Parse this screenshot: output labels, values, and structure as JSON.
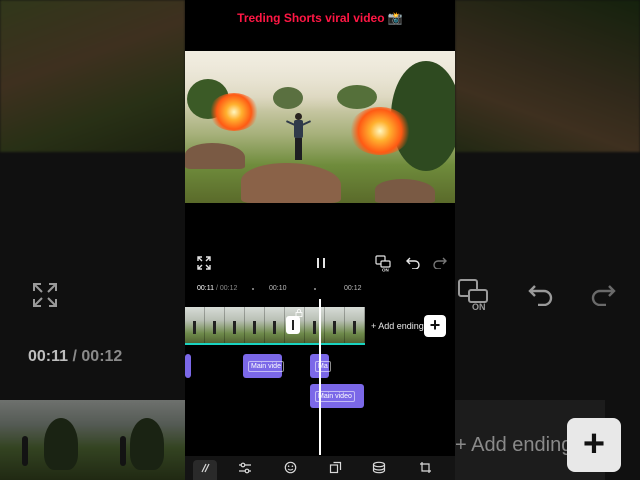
{
  "video_title": "Treding Shorts viral video 📸",
  "timeline": {
    "current_time": "00:11",
    "separator": " / ",
    "total_time": "00:12",
    "ruler_labels": [
      "00:10",
      "00:12"
    ]
  },
  "controls": {
    "fullscreen_icon": "fullscreen-icon",
    "pause_icon": "pause-icon",
    "keyframe_icon": "keyframe-on-icon",
    "keyframe_badge": "ON",
    "undo_icon": "undo-icon",
    "redo_icon": "redo-icon"
  },
  "track": {
    "add_ending_label": "+ Add ending",
    "add_button_label": "+"
  },
  "clips": [
    {
      "label": "Main vide"
    },
    {
      "label": "Main video"
    },
    {
      "label": "Ma"
    },
    {
      "label": "Main video"
    }
  ],
  "toolbar_icons": [
    "collapse-icon",
    "adjust-icon",
    "sticker-icon",
    "overlay-icon",
    "effects-icon",
    "crop-icon"
  ],
  "colors": {
    "title": "#ff1744",
    "clip": "#7b68e8",
    "track_underline": "#1ad3c1"
  }
}
